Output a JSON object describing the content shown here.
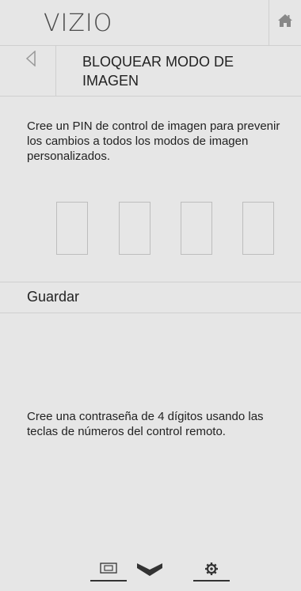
{
  "header": {
    "logo": "VIZIO",
    "home_icon": "home-icon"
  },
  "title_bar": {
    "back_icon": "back-triangle-icon",
    "title": "BLOQUEAR MODO DE IMAGEN"
  },
  "description": "Cree un PIN de control de imagen para prevenir los cambios a todos los modos de imagen personalizados.",
  "pin": {
    "digits": [
      "",
      "",
      "",
      ""
    ]
  },
  "save": {
    "label": "Guardar"
  },
  "hint": "Cree una contraseña de 4 dígitos usando las teclas de números del control remoto.",
  "bottom_nav": {
    "items": [
      "wide-screen-icon",
      "chevron-down-icon",
      "gear-icon"
    ]
  },
  "colors": {
    "background": "#e6e6e6",
    "divider": "#cfcfcf",
    "text": "#222222",
    "icon": "#333333"
  }
}
